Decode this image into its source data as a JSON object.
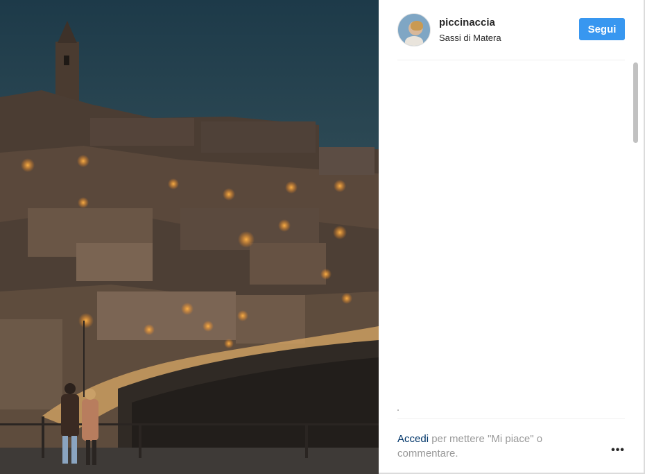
{
  "post": {
    "username": "piccinaccia",
    "location": "Sassi di Matera",
    "follow_label": "Segui"
  },
  "footer": {
    "login_link": "Accedi",
    "login_prompt": " per mettere \"Mi piace\" o commentare.",
    "more_label": "•••"
  },
  "colors": {
    "follow_button": "#3897f0",
    "login_link": "#003569",
    "muted_text": "#999999"
  },
  "icons": {
    "more": "ellipsis-horizontal-icon"
  }
}
